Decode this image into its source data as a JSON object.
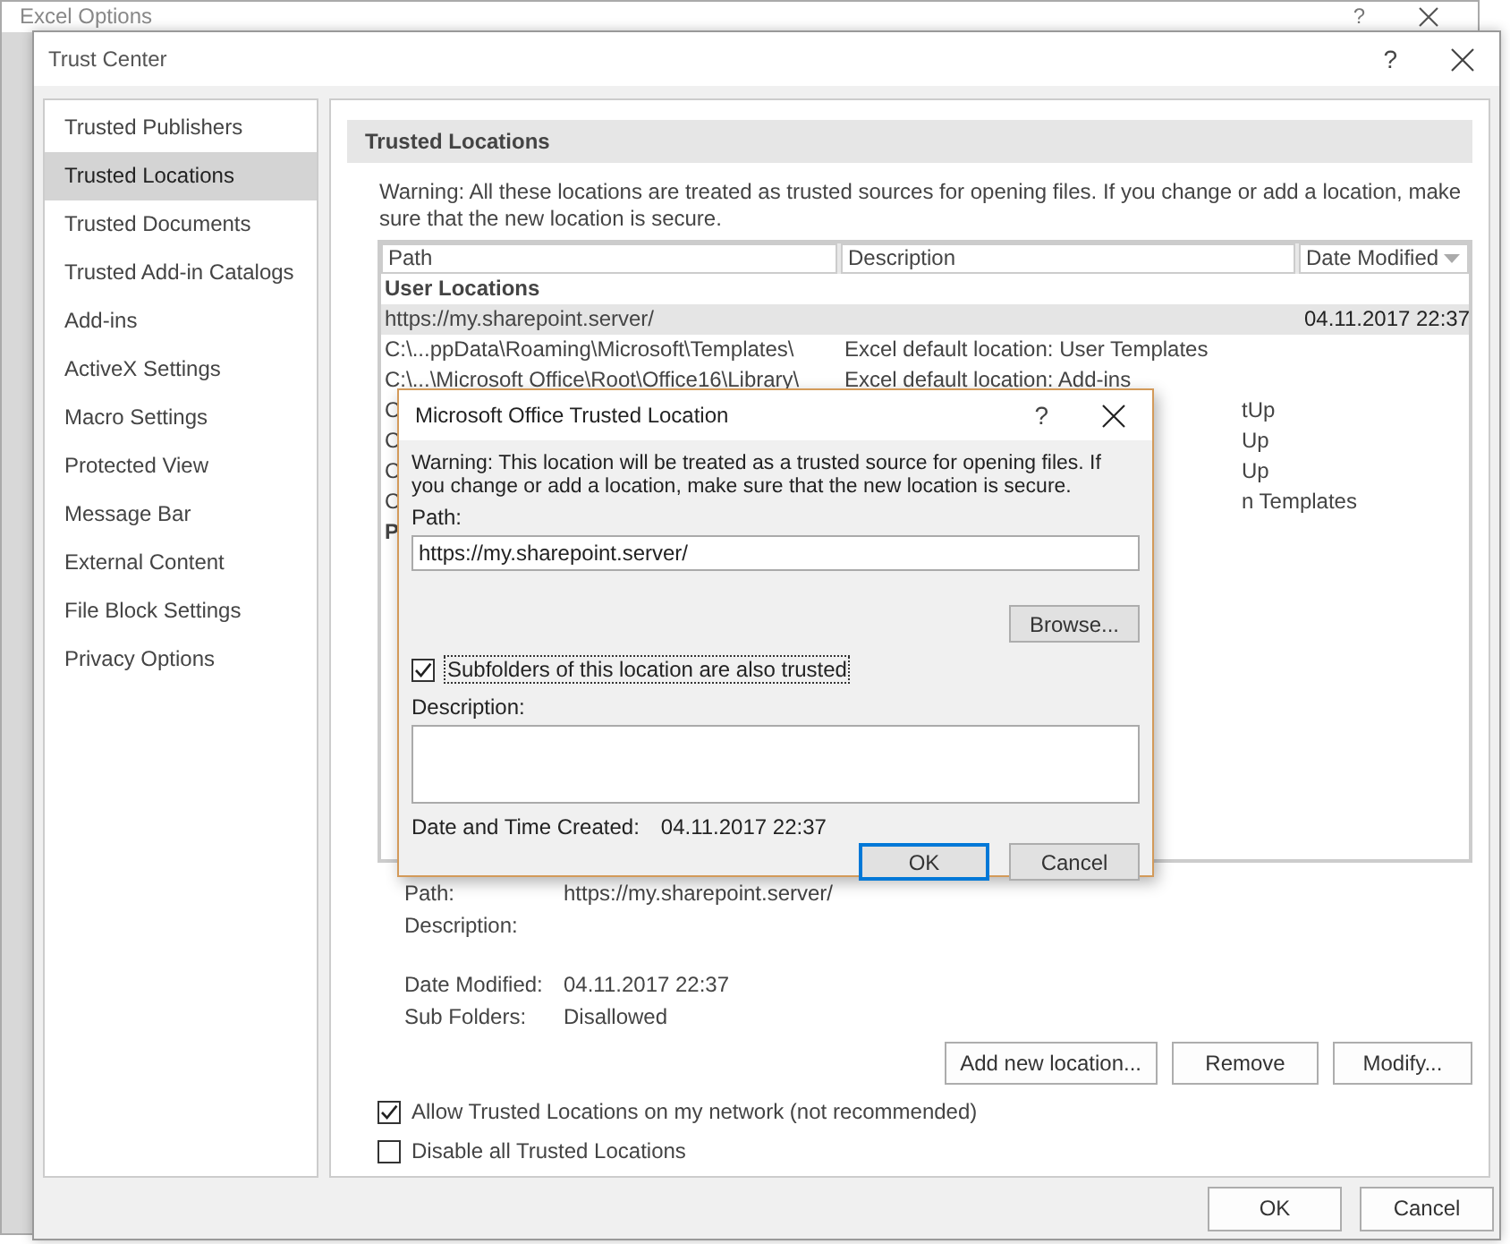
{
  "background_window": {
    "title": "Excel Options",
    "help": "?"
  },
  "window": {
    "title": "Trust Center",
    "help": "?"
  },
  "sidebar": {
    "items": [
      {
        "label": "Trusted Publishers",
        "selected": false
      },
      {
        "label": "Trusted Locations",
        "selected": true
      },
      {
        "label": "Trusted Documents",
        "selected": false
      },
      {
        "label": "Trusted Add-in Catalogs",
        "selected": false
      },
      {
        "label": "Add-ins",
        "selected": false
      },
      {
        "label": "ActiveX Settings",
        "selected": false
      },
      {
        "label": "Macro Settings",
        "selected": false
      },
      {
        "label": "Protected View",
        "selected": false
      },
      {
        "label": "Message Bar",
        "selected": false
      },
      {
        "label": "External Content",
        "selected": false
      },
      {
        "label": "File Block Settings",
        "selected": false
      },
      {
        "label": "Privacy Options",
        "selected": false
      }
    ]
  },
  "panel": {
    "heading": "Trusted Locations",
    "warning": "Warning: All these locations are treated as trusted sources for opening files.  If you change or add a location, make sure that the new location is secure.",
    "table": {
      "columns": [
        "Path",
        "Description",
        "Date Modified"
      ],
      "groups": [
        {
          "label": "User Locations",
          "rows": [
            {
              "kind": "full",
              "path": "https://my.sharepoint.server/",
              "date": "04.11.2017 22:37",
              "selected": true
            },
            {
              "kind": "full",
              "path": "C:\\...ppData\\Roaming\\Microsoft\\Templates\\",
              "description": "Excel default location: User Templates",
              "selected": false
            },
            {
              "kind": "full",
              "path": "C:\\...\\Microsoft Office\\Root\\Office16\\Library\\",
              "description": "Excel default location: Add-ins",
              "selected": false
            },
            {
              "kind": "partial",
              "path": "C",
              "description": "tUp",
              "selected": false
            },
            {
              "kind": "partial",
              "path": "C",
              "description": "Up",
              "selected": false
            },
            {
              "kind": "partial",
              "path": "C",
              "description": "Up",
              "selected": false
            },
            {
              "kind": "partial",
              "path": "C",
              "description": "n Templates",
              "selected": false
            }
          ]
        },
        {
          "label": "P"
        }
      ]
    },
    "details": [
      {
        "label": "Path:",
        "value": "https://my.sharepoint.server/"
      },
      {
        "label": "Description:"
      },
      {
        "label": "Date Modified:",
        "value": "04.11.2017 22:37"
      },
      {
        "label": "Sub Folders:",
        "value": "Disallowed"
      }
    ],
    "location_buttons": [
      "Add new location...",
      "Remove",
      "Modify..."
    ],
    "options": [
      {
        "label": "Allow Trusted Locations on my network (not recommended)",
        "checked": true
      },
      {
        "label": "Disable all Trusted Locations",
        "checked": false
      }
    ]
  },
  "footer_buttons": [
    "OK",
    "Cancel"
  ],
  "dialog": {
    "title": "Microsoft Office Trusted Location",
    "help": "?",
    "warning": "Warning: This location will be treated as a trusted source for opening files. If you change or add a location, make sure that the new location is secure.",
    "path_label": "Path:",
    "path_value": "https://my.sharepoint.server/",
    "browse": "Browse...",
    "subfolders": {
      "label": "Subfolders of this location are also trusted",
      "checked": true
    },
    "description_label": "Description:",
    "created_label": "Date and Time Created:",
    "created_value": "04.11.2017 22:37",
    "buttons": [
      {
        "label": "OK",
        "default": true
      },
      {
        "label": "Cancel",
        "default": false
      }
    ]
  }
}
